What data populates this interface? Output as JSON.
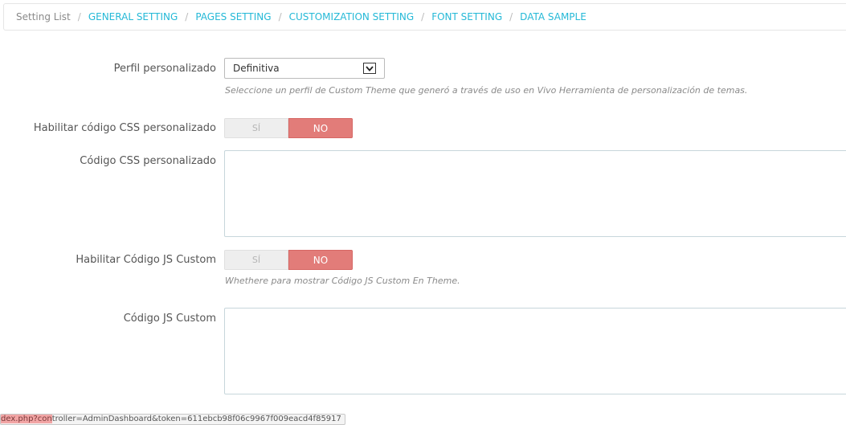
{
  "breadcrumb": {
    "root": "Setting List",
    "items": [
      "GENERAL SETTING",
      "PAGES SETTING",
      "CUSTOMIZATION SETTING",
      "FONT SETTING",
      "DATA SAMPLE"
    ]
  },
  "profile": {
    "label": "Perfil personalizado",
    "value": "Definitiva",
    "help": "Seleccione un perfil de Custom Theme que generó a través de uso en Vivo Herramienta de personalización de temas."
  },
  "css_enable": {
    "label": "Habilitar código CSS personalizado",
    "yes": "SÍ",
    "no": "NO",
    "selected": "NO"
  },
  "css_code": {
    "label": "Código CSS personalizado",
    "value": ""
  },
  "js_enable": {
    "label": "Habilitar Código JS Custom",
    "yes": "SÍ",
    "no": "NO",
    "selected": "NO",
    "help": "Whethere para mostrar Código JS Custom En Theme."
  },
  "js_code": {
    "label": "Código JS Custom",
    "value": ""
  },
  "statusbar": {
    "highlight": "dex.php?con",
    "rest": "troller=AdminDashboard&token=611ebcb98f06c9967f009eacd4f85917"
  }
}
